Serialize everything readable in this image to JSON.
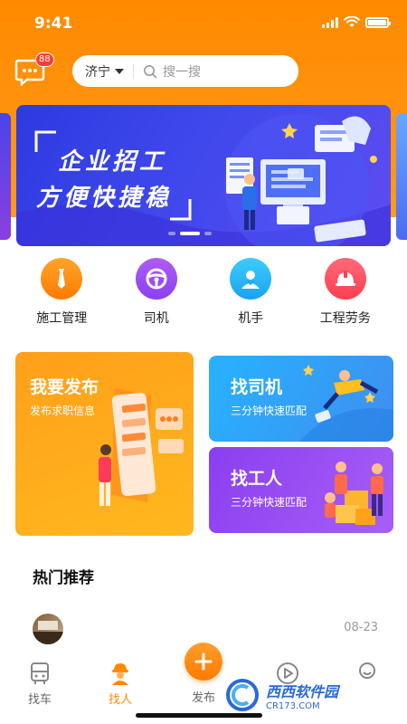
{
  "status_bar": {
    "time": "9:41"
  },
  "header": {
    "message_badge": "88",
    "city": "济宁",
    "search_placeholder": "搜一搜"
  },
  "banner": {
    "line1": "企业招工",
    "line2": "方便快捷稳",
    "active_slide": 2,
    "slide_count": 3
  },
  "categories": [
    {
      "label": "施工管理",
      "icon": "tie-icon",
      "color": "#ff8a00"
    },
    {
      "label": "司机",
      "icon": "steering-wheel-icon",
      "color": "#9b4cf2"
    },
    {
      "label": "机手",
      "icon": "operator-icon",
      "color": "#2ab6f5"
    },
    {
      "label": "工程劳务",
      "icon": "helmet-icon",
      "color": "#ff4d5e"
    }
  ],
  "cards": {
    "publish": {
      "title": "我要发布",
      "subtitle": "发布求职信息"
    },
    "driver": {
      "title": "找司机",
      "subtitle": "三分钟快速匹配"
    },
    "worker": {
      "title": "找工人",
      "subtitle": "三分钟快速匹配"
    }
  },
  "recommend": {
    "title": "热门推荐",
    "items": [
      {
        "date": "08-23"
      }
    ]
  },
  "tabbar": {
    "items": [
      {
        "label": "找车",
        "icon": "bus-icon"
      },
      {
        "label": "找人",
        "icon": "worker-icon",
        "active": true
      },
      {
        "label": "发布",
        "icon": "plus-icon"
      },
      {
        "label": "",
        "icon": "video-icon"
      },
      {
        "label": "",
        "icon": "profile-icon"
      }
    ]
  },
  "watermark": {
    "title": "西西软件园",
    "url": "CR173.COM"
  },
  "colors": {
    "primary": "#ff8a00",
    "banner": "#3f48ec",
    "driver": "#27b2ff",
    "worker": "#8a3ff0"
  }
}
